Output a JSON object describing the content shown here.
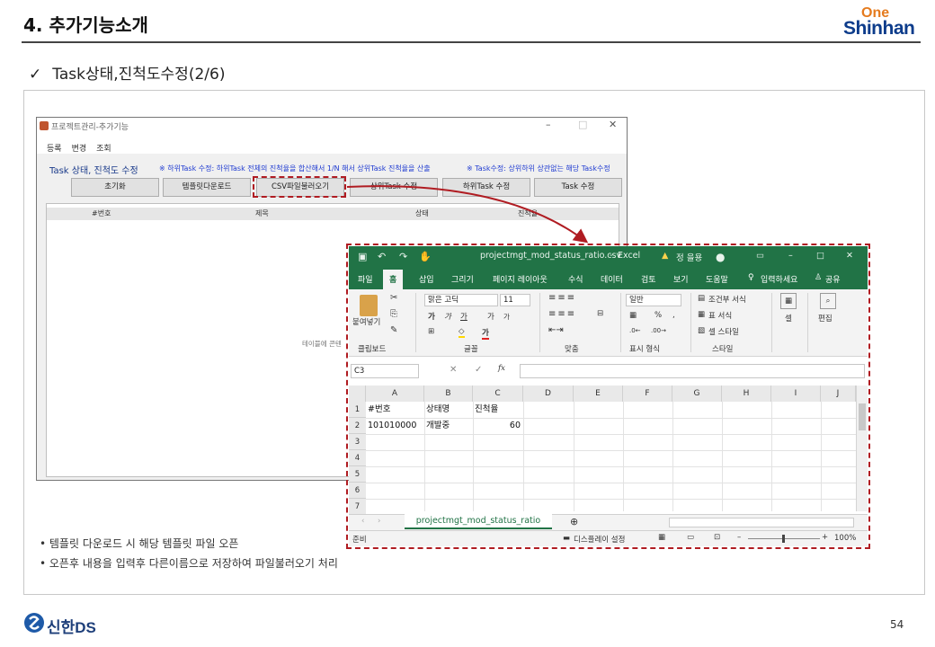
{
  "slide": {
    "title": "4. 추가기능소개",
    "brand_top": "One",
    "brand_bottom": "Shinhan",
    "check": "✓",
    "subtitle": "Task상태,진척도수정(2/6)",
    "page_number": "54",
    "footer_brand": "신한DS"
  },
  "app": {
    "window_title": "프로젝트관리-추가기능",
    "window_controls": [
      "–",
      "□",
      "✕"
    ],
    "menu": [
      "등록",
      "변경",
      "조회"
    ],
    "section_title": "Task 상태, 진척도 수정",
    "note_left": "※ 하위Task 수정: 하위Task 전체의 진척율을 합산해서 1/N 해서 상위Task 진척율을 산출",
    "note_right": "※ Task수정: 상위하위 상관없는 해당 Task수정",
    "buttons": [
      "초기화",
      "템플릿다운로드",
      "CSV파일불러오기",
      "상위Task 수정",
      "하위Task 수정",
      "Task 수정"
    ],
    "grid_columns": [
      "#번호",
      "제목",
      "상태",
      "진척율"
    ],
    "empty_message": "테이블에 콘텐"
  },
  "excel": {
    "filename": "projectmgt_mod_status_ratio.csv",
    "app_name": "Excel",
    "warning": "정 을용",
    "tabs": [
      "파일",
      "홈",
      "삽입",
      "그리기",
      "페이지 레이아웃",
      "수식",
      "데이터",
      "검토",
      "보기",
      "도움말"
    ],
    "search_label": "입력하세요",
    "share_label": "공유",
    "ribbon": {
      "paste": "붙여넣기",
      "clipboard": "클립보드",
      "font_name": "맑은 고딕",
      "font_size": "11",
      "font_group": "글꼴",
      "align_group": "맞춤",
      "number_format": "일반",
      "number_group": "표시 형식",
      "cond_format": "조건부 서식",
      "table_format": "표 서식",
      "cell_style": "셀 스타일",
      "style_group": "스타일",
      "cells": "셀",
      "edit": "편집",
      "bold": "가",
      "italic": "가",
      "underline": "가",
      "grow": "가",
      "shrink": "가",
      "percent": "%",
      "comma": ","
    },
    "name_box": "C3",
    "fx": "fx",
    "columns": [
      "A",
      "B",
      "C",
      "D",
      "E",
      "F",
      "G",
      "H",
      "I",
      "J"
    ],
    "rows": [
      "1",
      "2",
      "3",
      "4",
      "5",
      "6",
      "7"
    ],
    "cells": {
      "a1": "#번호",
      "b1": "상태명",
      "c1": "진척율",
      "a2": "101010000",
      "b2": "개발중",
      "c2": "60"
    },
    "sheet_tab": "projectmgt_mod_status_ratio",
    "status_ready": "준비",
    "display_settings": "디스플레이 설정",
    "zoom": "100%",
    "colors": {
      "excel_green": "#217346",
      "callout_red": "#b01c22"
    }
  },
  "bullets": [
    "• 템플릿 다운로드 시 해당 템플릿 파일 오픈",
    "• 오픈후 내용을 입력후 다른이름으로 저장하여 파일불러오기 처리"
  ]
}
